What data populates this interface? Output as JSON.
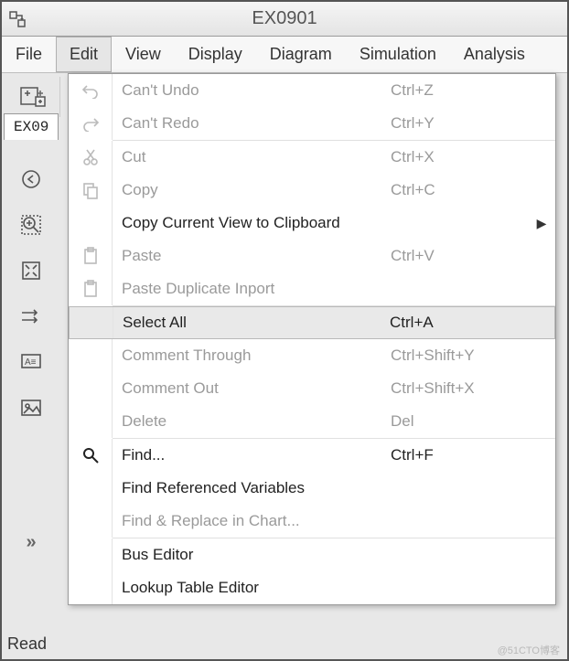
{
  "window": {
    "title": "EX0901"
  },
  "menubar": {
    "items": [
      "File",
      "Edit",
      "View",
      "Display",
      "Diagram",
      "Simulation",
      "Analysis"
    ],
    "active_index": 1
  },
  "tab": {
    "label": "EX09"
  },
  "statusbar": {
    "text": "Read"
  },
  "watermark": {
    "text": "@51CTO博客"
  },
  "menu": [
    {
      "type": "item",
      "icon": "undo",
      "label": "Can't Undo",
      "shortcut": "Ctrl+Z",
      "disabled": true
    },
    {
      "type": "item",
      "icon": "redo",
      "label": "Can't Redo",
      "shortcut": "Ctrl+Y",
      "disabled": true
    },
    {
      "type": "sep"
    },
    {
      "type": "item",
      "icon": "cut",
      "label": "Cut",
      "shortcut": "Ctrl+X",
      "disabled": true
    },
    {
      "type": "item",
      "icon": "copy",
      "label": "Copy",
      "shortcut": "Ctrl+C",
      "disabled": true
    },
    {
      "type": "item",
      "icon": "",
      "label": "Copy Current View to Clipboard",
      "shortcut": "",
      "submenu": true
    },
    {
      "type": "item",
      "icon": "paste",
      "label": "Paste",
      "shortcut": "Ctrl+V",
      "disabled": true
    },
    {
      "type": "item",
      "icon": "paste",
      "label": "Paste Duplicate Inport",
      "shortcut": "",
      "disabled": true
    },
    {
      "type": "sep"
    },
    {
      "type": "item",
      "icon": "",
      "label": "Select All",
      "shortcut": "Ctrl+A",
      "highlight": true
    },
    {
      "type": "item",
      "icon": "",
      "label": "Comment Through",
      "shortcut": "Ctrl+Shift+Y",
      "disabled": true
    },
    {
      "type": "item",
      "icon": "",
      "label": "Comment Out",
      "shortcut": "Ctrl+Shift+X",
      "disabled": true
    },
    {
      "type": "item",
      "icon": "",
      "label": "Delete",
      "shortcut": "Del",
      "disabled": true
    },
    {
      "type": "sep"
    },
    {
      "type": "item",
      "icon": "search",
      "label": "Find...",
      "shortcut": "Ctrl+F"
    },
    {
      "type": "item",
      "icon": "",
      "label": "Find Referenced Variables",
      "shortcut": ""
    },
    {
      "type": "item",
      "icon": "",
      "label": "Find & Replace in Chart...",
      "shortcut": "",
      "disabled": true
    },
    {
      "type": "sep"
    },
    {
      "type": "item",
      "icon": "",
      "label": "Bus Editor",
      "shortcut": ""
    },
    {
      "type": "item",
      "icon": "",
      "label": "Lookup Table Editor",
      "shortcut": ""
    }
  ],
  "icons": {
    "sidebar": [
      "back",
      "zoom-in",
      "fit",
      "arrows-right",
      "annotation",
      "image"
    ]
  }
}
